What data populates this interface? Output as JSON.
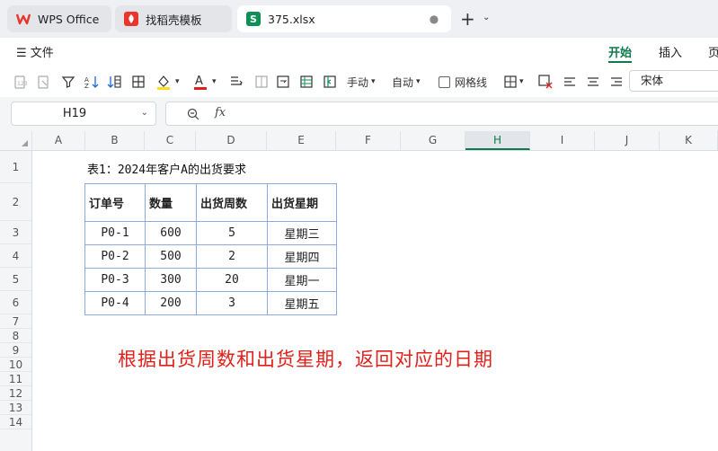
{
  "tabs": [
    {
      "label": "WPS Office",
      "icon": "wps-logo-icon",
      "color": "#e8362d"
    },
    {
      "label": "找稻壳模板",
      "icon": "docer-logo-icon",
      "color": "#e8362d"
    },
    {
      "label": "375.xlsx",
      "icon": "spreadsheet-file-icon",
      "color": "#0e8f56"
    }
  ],
  "menu": {
    "file": "文件",
    "tabs": [
      "开始",
      "插入",
      "页"
    ]
  },
  "toolbar": {
    "manual": "手动",
    "auto": "自动",
    "gridlines": "网格线",
    "font": "宋体",
    "font_color": "#e0211b",
    "highlight_color": "#f7e017"
  },
  "formula_bar": {
    "cell_ref": "H19",
    "fx": "fx",
    "formula": ""
  },
  "columns": [
    "A",
    "B",
    "C",
    "D",
    "E",
    "F",
    "G",
    "H",
    "I",
    "J",
    "K"
  ],
  "selected_column": "H",
  "rows": [
    "1",
    "2",
    "3",
    "4",
    "5",
    "6",
    "7",
    "8",
    "9",
    "10",
    "11",
    "12",
    "13",
    "14"
  ],
  "sheet": {
    "caption": "表1：2024年客户A的出货要求",
    "headers": [
      "订单号",
      "数量",
      "出货周数",
      "出货星期"
    ],
    "data": [
      [
        "P0-1",
        "600",
        "5",
        "星期三"
      ],
      [
        "P0-2",
        "500",
        "2",
        "星期四"
      ],
      [
        "P0-3",
        "300",
        "20",
        "星期一"
      ],
      [
        "P0-4",
        "200",
        "3",
        "星期五"
      ]
    ],
    "note": "根据出货周数和出货星期，返回对应的日期",
    "note_color": "#e0211b"
  }
}
